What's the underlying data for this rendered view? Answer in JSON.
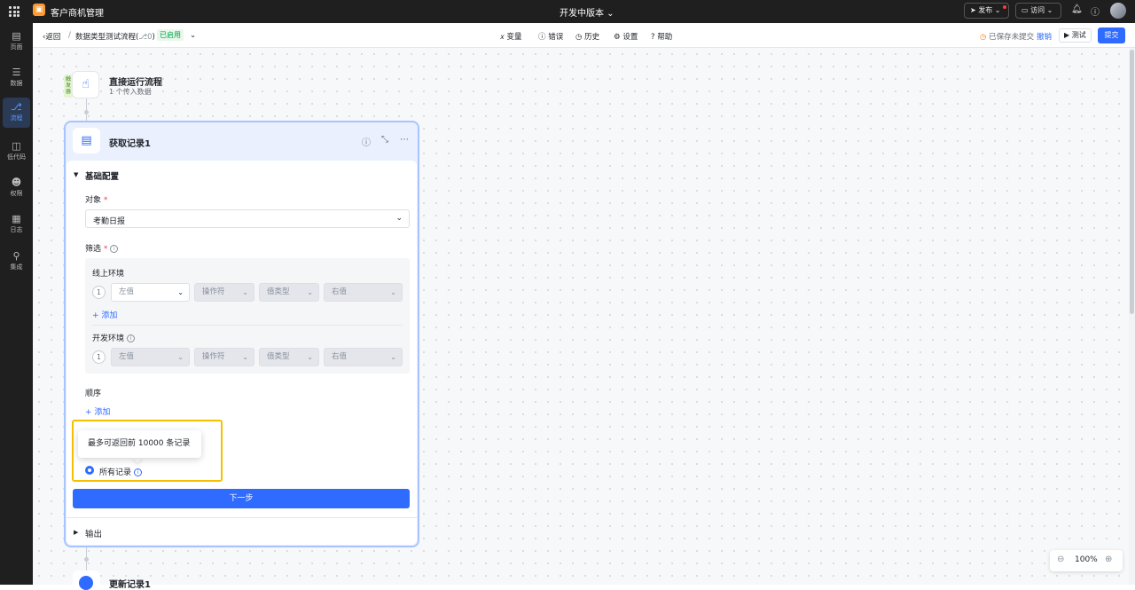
{
  "topbar": {
    "app_name": "客户商机管理",
    "version": "开发中版本 ⌄",
    "publish_label": "发布",
    "visit_label": "访问"
  },
  "sidebar": {
    "items": [
      {
        "label": "页面",
        "icon": "page-icon"
      },
      {
        "label": "数据",
        "icon": "database-icon"
      },
      {
        "label": "流程",
        "icon": "flow-icon",
        "active": true
      },
      {
        "label": "低代码",
        "icon": "code-icon"
      },
      {
        "label": "权限",
        "icon": "permission-icon"
      },
      {
        "label": "日志",
        "icon": "log-icon"
      },
      {
        "label": "集成",
        "icon": "integration-icon"
      }
    ]
  },
  "subbar": {
    "back_label": "返回",
    "separator": "/",
    "flow_name": "数据类型测试流程(",
    "flow_ver": "⎇0",
    "flow_close": ")",
    "status": "已启用",
    "tools": [
      "变量",
      "错误",
      "历史",
      "设置",
      "帮助"
    ],
    "save_status": "已保存未提交",
    "undo_label": "撤销",
    "test_label": "测试",
    "submit_label": "提交"
  },
  "trigger": {
    "tag": "触发器",
    "title": "直接运行流程",
    "subtitle": "1 个传入数据"
  },
  "node": {
    "title": "获取记录1",
    "section_basic": "基础配置",
    "object_label": "对象",
    "object_value": "考勤日报",
    "filter_label": "筛选",
    "online_env": "线上环境",
    "dev_env": "开发环境",
    "row_index": "1",
    "left_value": "左值",
    "operator": "操作符",
    "value_type": "值类型",
    "right_value": "右值",
    "add_label": "添加",
    "order_label": "顺序",
    "tooltip": "最多可返回前 10000 条记录",
    "all_records": "所有记录",
    "next_label": "下一步",
    "output_label": "输出"
  },
  "next_node": {
    "title": "更新记录1"
  },
  "zoom": {
    "value": "100%"
  },
  "colors": {
    "accent": "#2f6bff",
    "highlight": "#f5c000",
    "topbar": "#1f1f1f"
  }
}
